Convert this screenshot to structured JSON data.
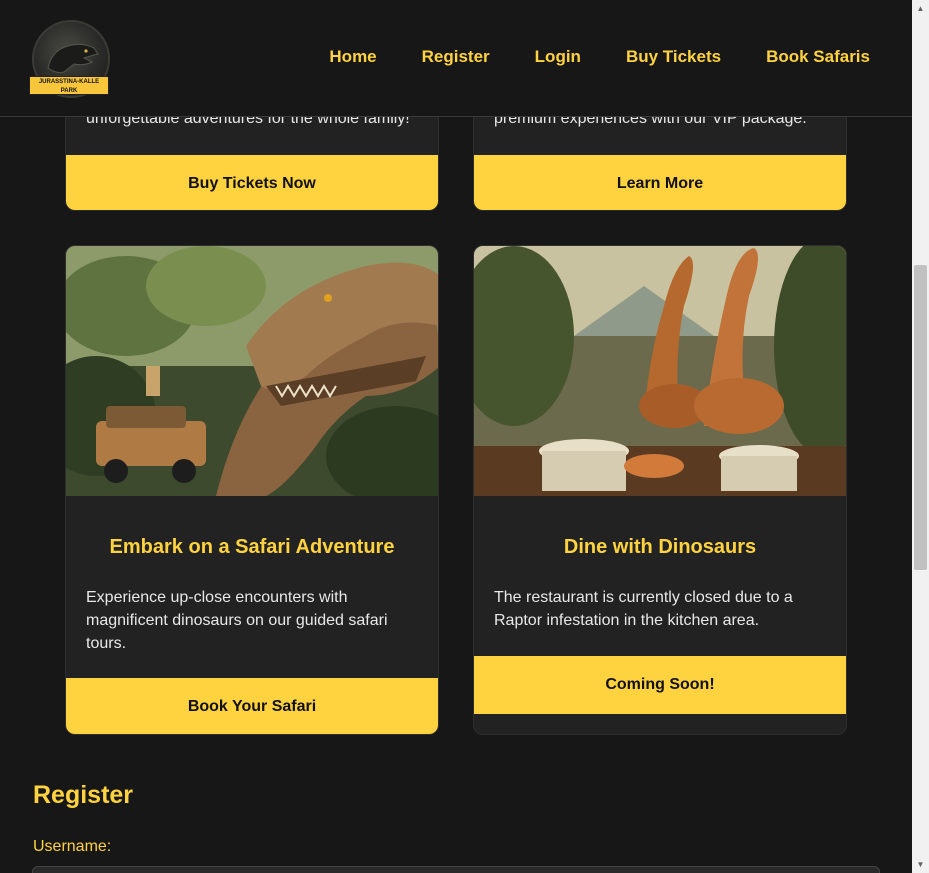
{
  "brand": {
    "logo_text": "JURASSTINA-KALLE PARK"
  },
  "nav": [
    {
      "label": "Home"
    },
    {
      "label": "Register"
    },
    {
      "label": "Login"
    },
    {
      "label": "Buy Tickets"
    },
    {
      "label": "Book Safaris"
    }
  ],
  "top_cards": [
    {
      "desc_tail": "unforgettable adventures for the whole family!",
      "button": "Buy Tickets Now"
    },
    {
      "desc_tail": "premium experiences with our VIP package.",
      "button": "Learn More"
    }
  ],
  "cards": [
    {
      "title": "Embark on a Safari Adventure",
      "description": "Experience up-close encounters with magnificent dinosaurs on our guided safari tours.",
      "button": "Book Your Safari",
      "image": "trex-safari-jeep"
    },
    {
      "title": "Dine with Dinosaurs",
      "description": "The restaurant is currently closed due to a Raptor infestation in the kitchen area.",
      "button": "Coming Soon!",
      "image": "dinosaur-restaurant"
    }
  ],
  "register": {
    "title": "Register",
    "username_label": "Username:"
  },
  "colors": {
    "accent": "#ffd23f",
    "background": "#171717",
    "card": "#222222"
  }
}
